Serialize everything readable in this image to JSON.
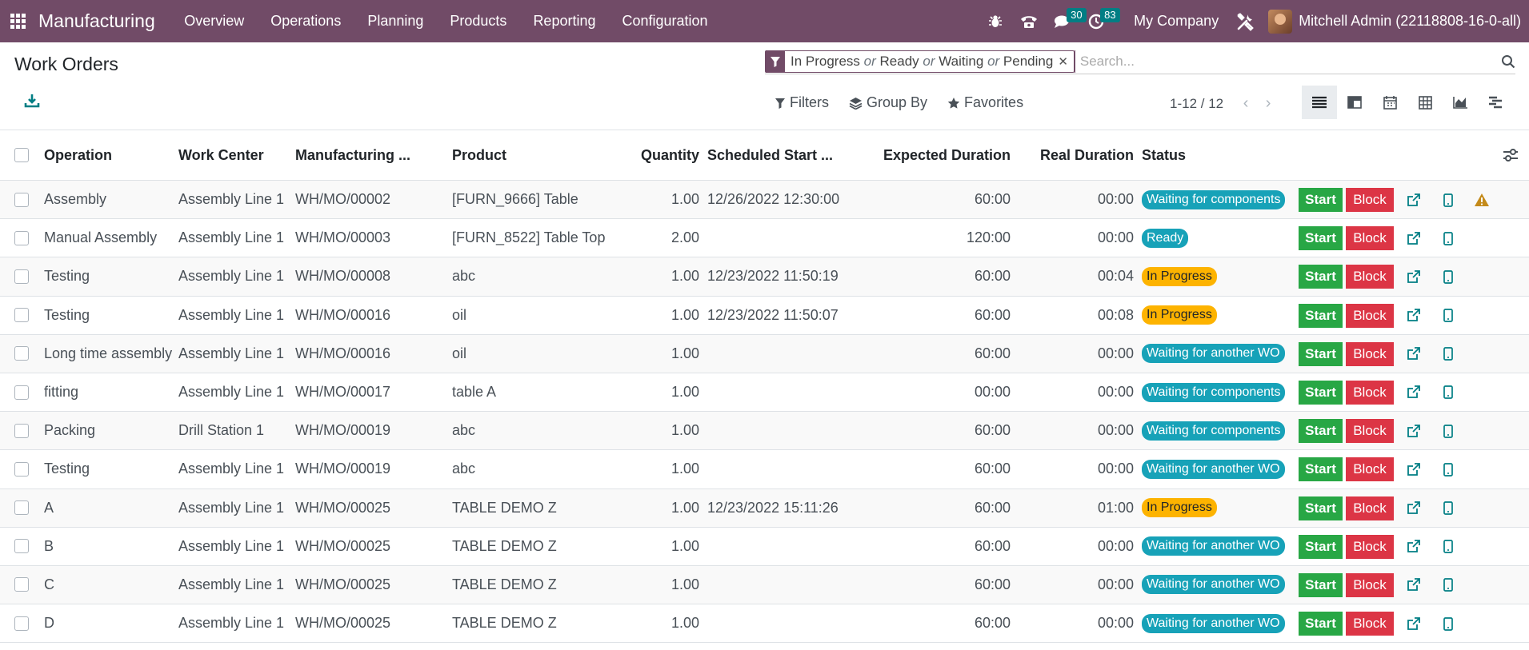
{
  "navbar": {
    "brand": "Manufacturing",
    "menu": [
      "Overview",
      "Operations",
      "Planning",
      "Products",
      "Reporting",
      "Configuration"
    ],
    "messages_count": "30",
    "activities_count": "83",
    "company": "My Company",
    "user": "Mitchell Admin (22118808-16-0-all)"
  },
  "page": {
    "title": "Work Orders"
  },
  "search": {
    "facet_values": [
      "In Progress",
      "Ready",
      "Waiting",
      "Pending"
    ],
    "facet_separator": "or",
    "placeholder": "Search..."
  },
  "filters": {
    "filters_label": "Filters",
    "group_by_label": "Group By",
    "favorites_label": "Favorites"
  },
  "pager": {
    "value": "1-12 / 12"
  },
  "table": {
    "columns": {
      "operation": "Operation",
      "work_center": "Work Center",
      "manufacturing": "Manufacturing ...",
      "product": "Product",
      "quantity": "Quantity",
      "scheduled_start": "Scheduled Start ...",
      "expected_duration": "Expected Duration",
      "real_duration": "Real Duration",
      "status": "Status"
    },
    "start_label": "Start",
    "block_label": "Block",
    "rows": [
      {
        "operation": "Assembly",
        "work_center": "Assembly Line 1",
        "mo": "WH/MO/00002",
        "product": "[FURN_9666] Table",
        "qty": "1.00",
        "start": "12/26/2022 12:30:00",
        "expected": "60:00",
        "real": "00:00",
        "status": "Waiting for components",
        "status_kind": "waiting",
        "warning": true
      },
      {
        "operation": "Manual Assembly",
        "work_center": "Assembly Line 1",
        "mo": "WH/MO/00003",
        "product": "[FURN_8522] Table Top",
        "qty": "2.00",
        "start": "",
        "expected": "120:00",
        "real": "00:00",
        "status": "Ready",
        "status_kind": "ready",
        "warning": false
      },
      {
        "operation": "Testing",
        "work_center": "Assembly Line 1",
        "mo": "WH/MO/00008",
        "product": "abc",
        "qty": "1.00",
        "start": "12/23/2022 11:50:19",
        "expected": "60:00",
        "real": "00:04",
        "status": "In Progress",
        "status_kind": "progress",
        "warning": false
      },
      {
        "operation": "Testing",
        "work_center": "Assembly Line 1",
        "mo": "WH/MO/00016",
        "product": "oil",
        "qty": "1.00",
        "start": "12/23/2022 11:50:07",
        "expected": "60:00",
        "real": "00:08",
        "status": "In Progress",
        "status_kind": "progress",
        "warning": false
      },
      {
        "operation": "Long time assembly",
        "work_center": "Assembly Line 1",
        "mo": "WH/MO/00016",
        "product": "oil",
        "qty": "1.00",
        "start": "",
        "expected": "60:00",
        "real": "00:00",
        "status": "Waiting for another WO",
        "status_kind": "waiting",
        "warning": false
      },
      {
        "operation": "fitting",
        "work_center": "Assembly Line 1",
        "mo": "WH/MO/00017",
        "product": "table A",
        "qty": "1.00",
        "start": "",
        "expected": "00:00",
        "real": "00:00",
        "status": "Waiting for components",
        "status_kind": "waiting",
        "warning": false
      },
      {
        "operation": "Packing",
        "work_center": "Drill Station 1",
        "mo": "WH/MO/00019",
        "product": "abc",
        "qty": "1.00",
        "start": "",
        "expected": "60:00",
        "real": "00:00",
        "status": "Waiting for components",
        "status_kind": "waiting",
        "warning": false
      },
      {
        "operation": "Testing",
        "work_center": "Assembly Line 1",
        "mo": "WH/MO/00019",
        "product": "abc",
        "qty": "1.00",
        "start": "",
        "expected": "60:00",
        "real": "00:00",
        "status": "Waiting for another WO",
        "status_kind": "waiting",
        "warning": false
      },
      {
        "operation": "A",
        "work_center": "Assembly Line 1",
        "mo": "WH/MO/00025",
        "product": "TABLE DEMO Z",
        "qty": "1.00",
        "start": "12/23/2022 15:11:26",
        "expected": "60:00",
        "real": "01:00",
        "status": "In Progress",
        "status_kind": "progress",
        "warning": false
      },
      {
        "operation": "B",
        "work_center": "Assembly Line 1",
        "mo": "WH/MO/00025",
        "product": "TABLE DEMO Z",
        "qty": "1.00",
        "start": "",
        "expected": "60:00",
        "real": "00:00",
        "status": "Waiting for another WO",
        "status_kind": "waiting",
        "warning": false
      },
      {
        "operation": "C",
        "work_center": "Assembly Line 1",
        "mo": "WH/MO/00025",
        "product": "TABLE DEMO Z",
        "qty": "1.00",
        "start": "",
        "expected": "60:00",
        "real": "00:00",
        "status": "Waiting for another WO",
        "status_kind": "waiting",
        "warning": false
      },
      {
        "operation": "D",
        "work_center": "Assembly Line 1",
        "mo": "WH/MO/00025",
        "product": "TABLE DEMO Z",
        "qty": "1.00",
        "start": "",
        "expected": "60:00",
        "real": "00:00",
        "status": "Waiting for another WO",
        "status_kind": "waiting",
        "warning": false
      }
    ]
  },
  "colors": {
    "navbar": "#714b67",
    "start": "#28a745",
    "block": "#dc3545",
    "waiting": "#17a2b8",
    "progress": "#fdb300",
    "badge": "#017e84"
  }
}
